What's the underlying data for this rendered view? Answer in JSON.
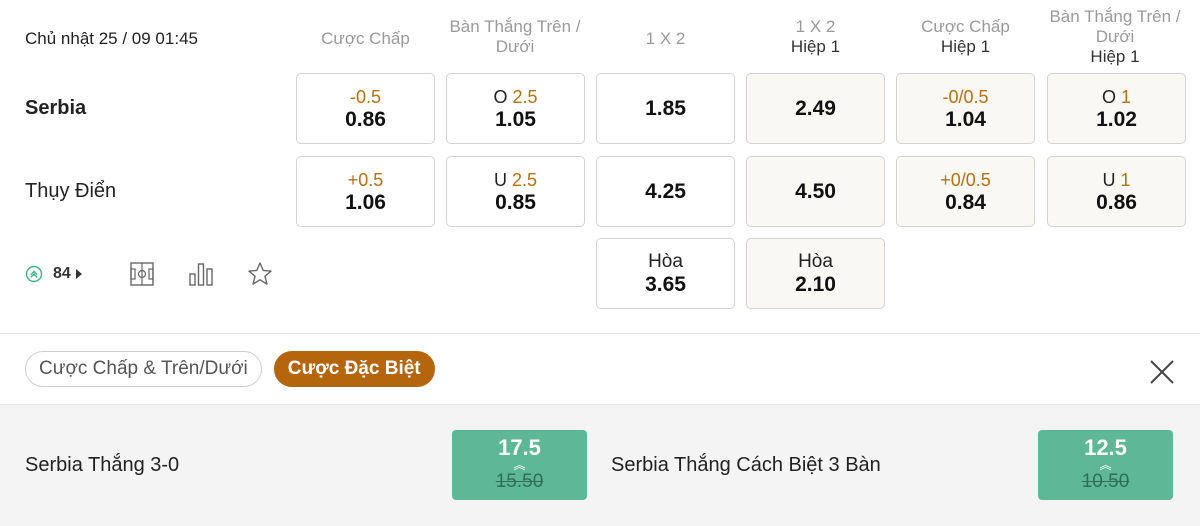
{
  "match": {
    "datetime": "Chủ nhật 25 / 09 01:45",
    "home": "Serbia",
    "away": "Thụy Điển"
  },
  "headers": [
    {
      "title": "Cược Chấp",
      "sub": ""
    },
    {
      "title": "Bàn Thắng Trên / Dưới",
      "sub": ""
    },
    {
      "title": "1 X 2",
      "sub": ""
    },
    {
      "title": "1 X 2",
      "sub": "Hiệp 1"
    },
    {
      "title": "Cược Chấp",
      "sub": "Hiệp 1"
    },
    {
      "title": "Bàn Thắng Trên / Dưới",
      "sub": "Hiệp 1"
    }
  ],
  "odds": {
    "home": {
      "handicap": {
        "line": "-0.5",
        "odd": "0.86"
      },
      "ou": {
        "pre": "O",
        "line": "2.5",
        "odd": "1.05"
      },
      "x12": {
        "odd": "1.85"
      },
      "x12_h1": {
        "odd": "2.49"
      },
      "handicap_h1": {
        "line": "-0/0.5",
        "odd": "1.04"
      },
      "ou_h1": {
        "pre": "O",
        "line": "1",
        "odd": "1.02"
      }
    },
    "away": {
      "handicap": {
        "line": "+0.5",
        "odd": "1.06"
      },
      "ou": {
        "pre": "U",
        "line": "2.5",
        "odd": "0.85"
      },
      "x12": {
        "odd": "4.25"
      },
      "x12_h1": {
        "odd": "4.50"
      },
      "handicap_h1": {
        "line": "+0/0.5",
        "odd": "0.84"
      },
      "ou_h1": {
        "pre": "U",
        "line": "1",
        "odd": "0.86"
      }
    },
    "draw": {
      "x12": {
        "label": "Hòa",
        "odd": "3.65"
      },
      "x12_h1": {
        "label": "Hòa",
        "odd": "2.10"
      }
    }
  },
  "toolbar": {
    "stats_count": "84",
    "icons": [
      "live-stream-icon",
      "field-icon",
      "bar-chart-icon",
      "star-icon"
    ]
  },
  "tabs": [
    {
      "label": "Cược Chấp & Trên/Dưới",
      "active": false
    },
    {
      "label": "Cược Đặc Biệt",
      "active": true
    }
  ],
  "specials": [
    {
      "label": "Serbia Thắng 3-0",
      "odd": "17.5",
      "old_odd": "15.50"
    },
    {
      "label": "Serbia Thắng Cách Biệt 3 Bàn",
      "odd": "12.5",
      "old_odd": "10.50"
    }
  ],
  "colors": {
    "accent": "#b5650c",
    "line_text": "#b8700f",
    "special_button": "#5eb898"
  }
}
